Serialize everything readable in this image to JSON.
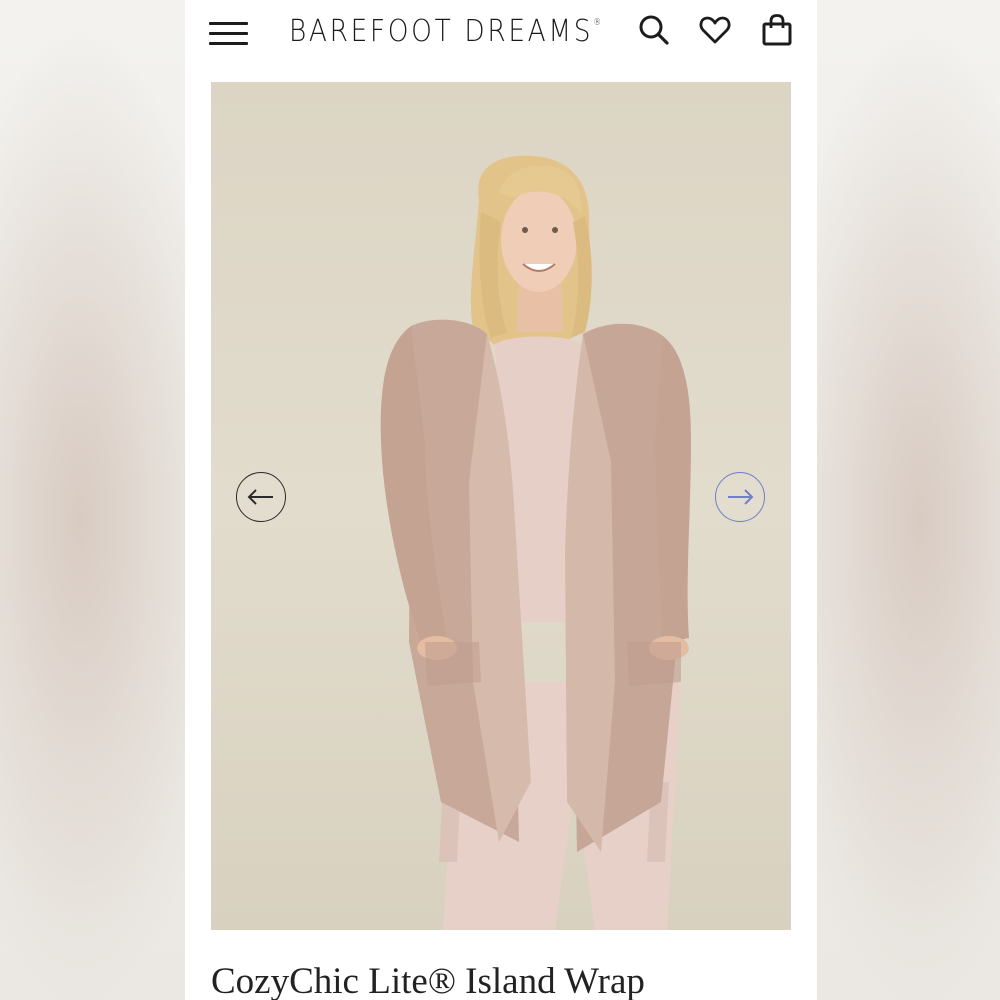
{
  "header": {
    "brand": "BAREFOOT DREAMS",
    "brand_mark": "®",
    "icons": [
      "menu-icon",
      "search-icon",
      "heart-icon",
      "bag-icon"
    ]
  },
  "gallery": {
    "prev_icon": "arrow-left-icon",
    "next_icon": "arrow-right-icon"
  },
  "product": {
    "title": "CozyChic Lite® Island Wrap"
  },
  "colors": {
    "background_beige": "#dcd5c4",
    "garment_rose": "#c9a99c",
    "next_arrow_accent": "#6f7fc9"
  }
}
